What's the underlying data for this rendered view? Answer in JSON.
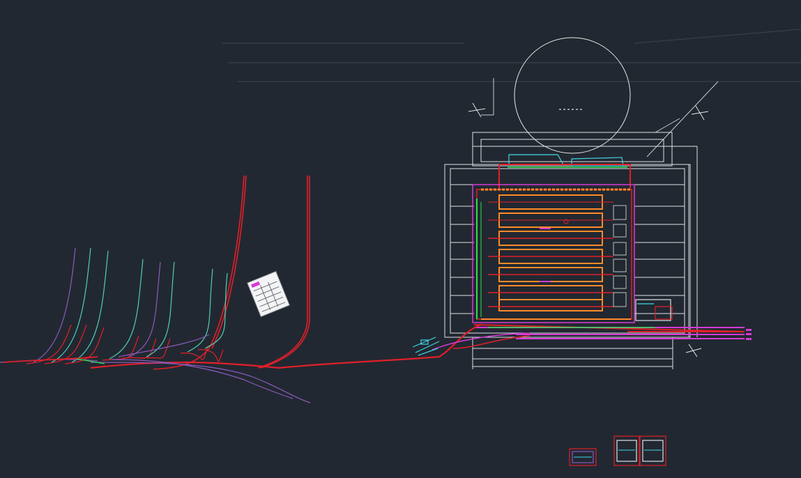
{
  "viewport": {
    "background": "#222831"
  },
  "colors": {
    "track_red": "#e0202a",
    "track_magenta": "#d63ad6",
    "track_purple": "#8a5cc0",
    "track_teal": "#4fd1b5",
    "line_white": "#e6e6e6",
    "line_grey": "#8a8f96",
    "orange": "#ff8a2a",
    "green": "#2ee04a",
    "cyan": "#3fd8e8"
  },
  "legend_sheet": {
    "icon": "legend-table-icon"
  },
  "detail_sheets": {
    "count": 3,
    "icon": "detail-drawing-icon"
  },
  "north_arrows": {
    "icon": "north-arrow-icon"
  }
}
